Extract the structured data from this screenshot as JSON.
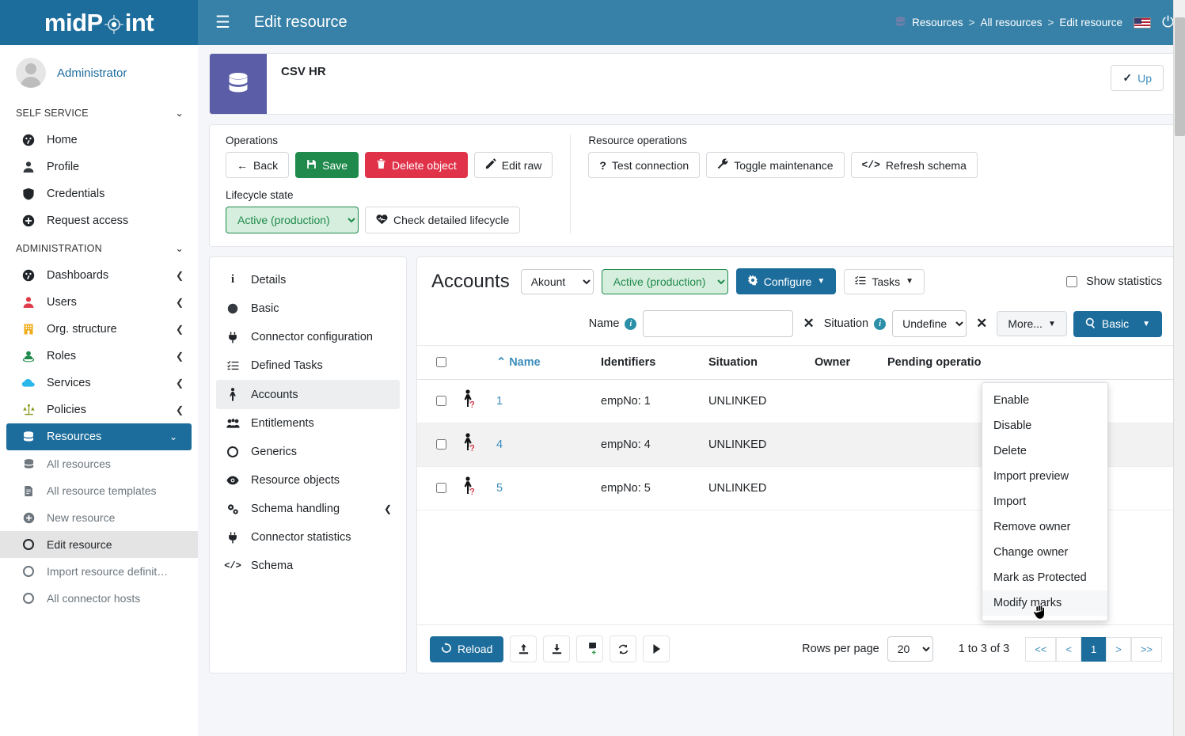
{
  "brand": {
    "name_part1": "mid",
    "name_part2": "P",
    "name_part3": "int",
    "logo_icon": "crosshair-gear-icon"
  },
  "user": {
    "name": "Administrator",
    "avatar_icon": "user-avatar-icon"
  },
  "sidebar": {
    "sections": [
      {
        "label": "SELF SERVICE",
        "caret": "chevron-down-icon"
      },
      {
        "label": "ADMINISTRATION",
        "caret": "chevron-down-icon"
      }
    ],
    "self_service_items": [
      {
        "label": "Home",
        "icon": "dashboard-icon",
        "color": "#212529"
      },
      {
        "label": "Profile",
        "icon": "user-icon",
        "color": "#343a40"
      },
      {
        "label": "Credentials",
        "icon": "shield-icon",
        "color": "#212529"
      },
      {
        "label": "Request access",
        "icon": "plus-circle-icon",
        "color": "#212529"
      }
    ],
    "administration_items": [
      {
        "label": "Dashboards",
        "icon": "dashboard-icon",
        "color": "#212529",
        "caret": "chevron-left-icon"
      },
      {
        "label": "Users",
        "icon": "user-icon",
        "color": "#e03b4a",
        "caret": "chevron-left-icon"
      },
      {
        "label": "Org. structure",
        "icon": "building-icon",
        "color": "#f0ad1e",
        "caret": "chevron-left-icon"
      },
      {
        "label": "Roles",
        "icon": "role-icon",
        "color": "#1f8a4c",
        "caret": "chevron-left-icon"
      },
      {
        "label": "Services",
        "icon": "cloud-icon",
        "color": "#29b6e8",
        "caret": "chevron-left-icon"
      },
      {
        "label": "Policies",
        "icon": "scales-icon",
        "color": "#8a9a1e",
        "caret": "chevron-left-icon"
      },
      {
        "label": "Resources",
        "icon": "database-icon",
        "color": "#ffffff",
        "caret": "chevron-down-icon",
        "active": true
      }
    ],
    "resource_subitems": [
      {
        "label": "All resources",
        "icon": "database-icon"
      },
      {
        "label": "All resource templates",
        "icon": "document-icon"
      },
      {
        "label": "New resource",
        "icon": "plus-circle-icon"
      },
      {
        "label": "Edit resource",
        "icon": "circle-icon",
        "selected": true
      },
      {
        "label": "Import resource definit…",
        "icon": "circle-icon"
      },
      {
        "label": "All connector hosts",
        "icon": "circle-icon"
      }
    ]
  },
  "topbar": {
    "menu_icon": "hamburger-icon",
    "title": "Edit resource",
    "breadcrumbs": [
      "Resources",
      "All resources",
      "Edit resource"
    ],
    "breadcrumb_icon": "database-icon",
    "separator": ">",
    "flag_icon": "us-flag-icon",
    "power_icon": "power-icon"
  },
  "resource": {
    "name": "CSV HR",
    "icon": "database-icon",
    "icon_color": "#5b5ea6",
    "status": {
      "label": "Up",
      "icon": "check-icon"
    }
  },
  "operations": {
    "label": "Operations",
    "buttons": [
      {
        "label": "Back",
        "icon": "arrow-left-icon",
        "style": "default"
      },
      {
        "label": "Save",
        "icon": "save-icon",
        "style": "green"
      },
      {
        "label": "Delete object",
        "icon": "trash-icon",
        "style": "red"
      },
      {
        "label": "Edit raw",
        "icon": "edit-icon",
        "style": "default"
      }
    ]
  },
  "resource_operations": {
    "label": "Resource operations",
    "buttons": [
      {
        "label": "Test connection",
        "icon": "question-icon"
      },
      {
        "label": "Toggle maintenance",
        "icon": "wrench-icon"
      },
      {
        "label": "Refresh schema",
        "icon": "code-icon"
      }
    ]
  },
  "lifecycle": {
    "label": "Lifecycle state",
    "selected": "Active (production)",
    "options": [
      "Active (production)"
    ],
    "check_button": {
      "label": "Check detailed lifecycle",
      "icon": "heartbeat-icon"
    }
  },
  "inner_nav": {
    "items": [
      {
        "label": "Details",
        "icon": "info-icon"
      },
      {
        "label": "Basic",
        "icon": "circle-filled-icon"
      },
      {
        "label": "Connector configuration",
        "icon": "plug-icon"
      },
      {
        "label": "Defined Tasks",
        "icon": "tasks-icon"
      },
      {
        "label": "Accounts",
        "icon": "person-icon",
        "active": true
      },
      {
        "label": "Entitlements",
        "icon": "users-group-icon"
      },
      {
        "label": "Generics",
        "icon": "circle-icon"
      },
      {
        "label": "Resource objects",
        "icon": "eye-icon"
      },
      {
        "label": "Schema handling",
        "icon": "cogs-icon",
        "caret": "chevron-left-icon"
      },
      {
        "label": "Connector statistics",
        "icon": "plug-icon"
      },
      {
        "label": "Schema",
        "icon": "code-icon"
      }
    ]
  },
  "accounts": {
    "title": "Accounts",
    "kind_select": {
      "selected": "Akount",
      "options": [
        "Akount"
      ]
    },
    "lifecycle_select": {
      "selected": "Active (production)",
      "options": [
        "Active (production)"
      ]
    },
    "configure_button": {
      "label": "Configure",
      "icon": "gear-icon",
      "caret": "caret-down-icon"
    },
    "tasks_button": {
      "label": "Tasks",
      "icon": "tasks-icon",
      "caret": "caret-down-icon"
    },
    "show_statistics": {
      "label": "Show statistics",
      "checked": false
    },
    "filters": {
      "name": {
        "label": "Name",
        "value": "",
        "placeholder": "",
        "info_icon": "info-circle-icon",
        "clear_icon": "close-icon"
      },
      "situation": {
        "label": "Situation",
        "selected": "Undefined",
        "options": [
          "Undefined"
        ],
        "info_icon": "info-circle-icon",
        "clear_icon": "close-icon"
      },
      "more_button": {
        "label": "More...",
        "caret": "caret-down-icon"
      },
      "search_button": {
        "label": "Basic",
        "icon": "search-icon",
        "caret": "caret-down-icon"
      }
    },
    "table": {
      "select_all_checkbox": false,
      "sort_icon": "chevron-up-icon",
      "columns": [
        "Name",
        "Identifiers",
        "Situation",
        "Owner",
        "Pending operatio"
      ],
      "rows": [
        {
          "checked": false,
          "icon": "person-unknown-icon",
          "name": "1",
          "identifiers": "empNo: 1",
          "situation": "UNLINKED",
          "owner": "",
          "pending": ""
        },
        {
          "checked": false,
          "icon": "person-unknown-icon",
          "name": "4",
          "identifiers": "empNo: 4",
          "situation": "UNLINKED",
          "owner": "",
          "pending": ""
        },
        {
          "checked": false,
          "icon": "person-unknown-icon",
          "name": "5",
          "identifiers": "empNo: 5",
          "situation": "UNLINKED",
          "owner": "",
          "pending": ""
        }
      ]
    },
    "footer": {
      "reload_button": {
        "label": "Reload",
        "icon": "refresh-icon"
      },
      "icon_buttons": [
        {
          "icon": "upload-icon"
        },
        {
          "icon": "download-icon"
        },
        {
          "icon": "chart-add-icon"
        },
        {
          "icon": "sync-icon"
        },
        {
          "icon": "play-icon"
        }
      ],
      "rows_per_page_label": "Rows per page",
      "rows_per_page_value": "20",
      "rows_per_page_options": [
        "20"
      ],
      "range_text": "1 to 3 of 3",
      "pager": [
        "<<",
        "<",
        "1",
        ">",
        ">>"
      ],
      "pager_active": "1"
    },
    "dropdown_menu": {
      "items": [
        {
          "label": "Enable"
        },
        {
          "label": "Disable"
        },
        {
          "label": "Delete"
        },
        {
          "label": "Import preview"
        },
        {
          "label": "Import"
        },
        {
          "label": "Remove owner"
        },
        {
          "label": "Change owner"
        },
        {
          "label": "Mark as Protected"
        },
        {
          "label": "Modify marks",
          "hovered": true
        }
      ]
    }
  },
  "colors": {
    "brand_blue": "#1d6d9c",
    "topbar_blue": "#3781a8",
    "green": "#1f8a4c",
    "red": "#e0334a",
    "purple": "#5b5ea6"
  }
}
